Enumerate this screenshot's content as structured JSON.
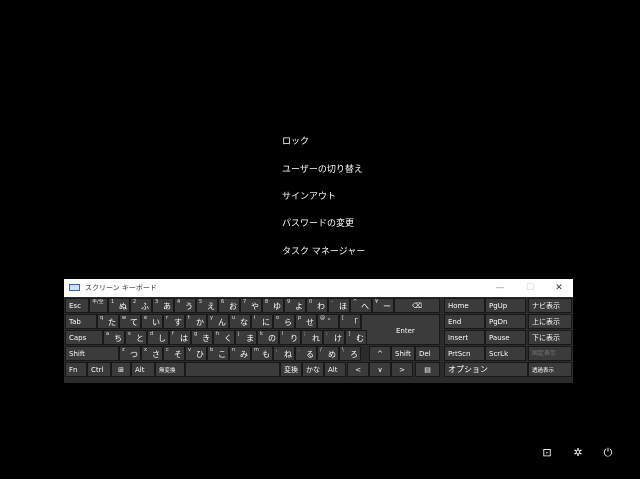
{
  "menu": {
    "items": [
      "ロック",
      "ユーザーの切り替え",
      "サインアウト",
      "パスワードの変更",
      "タスク マネージャー"
    ]
  },
  "osk": {
    "title": "スクリーン キーボード",
    "window_buttons": {
      "minimize": "—",
      "maximize": "☐",
      "close": "✕"
    },
    "keys": {
      "esc": "Esc",
      "zenhan": "半/全",
      "num": [
        {
          "d": "1",
          "k": "ぬ"
        },
        {
          "d": "2",
          "k": "ふ"
        },
        {
          "d": "3",
          "k": "あ"
        },
        {
          "d": "4",
          "k": "う"
        },
        {
          "d": "5",
          "k": "え"
        },
        {
          "d": "6",
          "k": "お"
        },
        {
          "d": "7",
          "k": "や"
        },
        {
          "d": "8",
          "k": "ゆ"
        },
        {
          "d": "9",
          "k": "よ"
        },
        {
          "d": "0",
          "k": "わ"
        },
        {
          "d": "-",
          "k": "ほ"
        },
        {
          "d": "^",
          "k": "へ"
        },
        {
          "d": "¥",
          "k": "ー"
        }
      ],
      "backspace": "⌫",
      "tab": "Tab",
      "qrow": [
        {
          "d": "q",
          "k": "た"
        },
        {
          "d": "w",
          "k": "て"
        },
        {
          "d": "e",
          "k": "い"
        },
        {
          "d": "r",
          "k": "す"
        },
        {
          "d": "t",
          "k": "か"
        },
        {
          "d": "y",
          "k": "ん"
        },
        {
          "d": "u",
          "k": "な"
        },
        {
          "d": "i",
          "k": "に"
        },
        {
          "d": "o",
          "k": "ら"
        },
        {
          "d": "p",
          "k": "せ"
        },
        {
          "d": "@",
          "k": "゛"
        },
        {
          "d": "[",
          "k": "「"
        }
      ],
      "enter": "Enter",
      "caps": "Caps",
      "arow": [
        {
          "d": "a",
          "k": "ち"
        },
        {
          "d": "s",
          "k": "と"
        },
        {
          "d": "d",
          "k": "し"
        },
        {
          "d": "f",
          "k": "は"
        },
        {
          "d": "g",
          "k": "き"
        },
        {
          "d": "h",
          "k": "く"
        },
        {
          "d": "j",
          "k": "ま"
        },
        {
          "d": "k",
          "k": "の"
        },
        {
          "d": "l",
          "k": "り"
        },
        {
          "d": ";",
          "k": "れ"
        },
        {
          "d": ":",
          "k": "け"
        },
        {
          "d": "]",
          "k": "む"
        }
      ],
      "shift_l": "Shift",
      "zrow": [
        {
          "d": "z",
          "k": "つ"
        },
        {
          "d": "x",
          "k": "さ"
        },
        {
          "d": "c",
          "k": "そ"
        },
        {
          "d": "v",
          "k": "ひ"
        },
        {
          "d": "b",
          "k": "こ"
        },
        {
          "d": "n",
          "k": "み"
        },
        {
          "d": "m",
          "k": "も"
        },
        {
          "d": ",",
          "k": "ね"
        },
        {
          "d": ".",
          "k": "る"
        },
        {
          "d": "/",
          "k": "め"
        },
        {
          "d": "\\",
          "k": "ろ"
        }
      ],
      "up": "^",
      "shift_r": "Shift",
      "del": "Del",
      "fn": "Fn",
      "ctrl": "Ctrl",
      "win": "⊞",
      "alt_l": "Alt",
      "muhenkan": "無変換",
      "henkan": "変換",
      "kana": "かな",
      "alt_r": "Alt",
      "left": "<",
      "down": "∨",
      "right": ">",
      "menu_key": "▤",
      "home": "Home",
      "pgup": "PgUp",
      "navi": "ナビ表示",
      "end": "End",
      "pgdn": "PgDn",
      "upshow": "上に表示",
      "insert": "Insert",
      "pause": "Pause",
      "downshow": "下に表示",
      "prtscn": "PrtScn",
      "scrlk": "ScrLk",
      "fixshow": "固定表示",
      "options": "オプション",
      "fade": "透過表示"
    }
  },
  "system": {
    "network_icon": "⊡",
    "accessibility_icon": "✲",
    "power_icon": "⏻"
  }
}
